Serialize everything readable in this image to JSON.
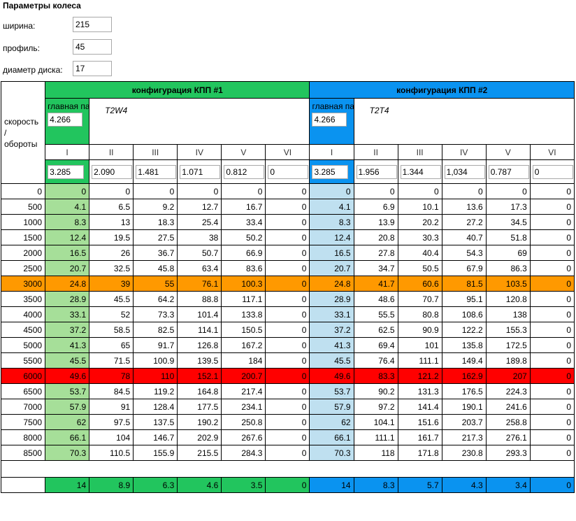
{
  "section_title": "Параметры колеса",
  "params": {
    "width_label": "ширина:",
    "width_value": "215",
    "profile_label": "профиль:",
    "profile_value": "45",
    "disk_label": "диаметр диска:",
    "disk_value": "17"
  },
  "table": {
    "speed_header": "скорость / обороты",
    "config1": {
      "title": "конфигурация КПП #1",
      "main_pair_label": "главная пара",
      "main_pair_value": "4.266",
      "name": "T2W4",
      "gears": [
        "I",
        "II",
        "III",
        "IV",
        "V",
        "VI"
      ],
      "ratios": [
        "3.285",
        "2.090",
        "1.481",
        "1.071",
        "0.812",
        "0"
      ]
    },
    "config2": {
      "title": "конфигурация КПП #2",
      "main_pair_label": "главная пара",
      "main_pair_value": "4.266",
      "name": "T2T4",
      "gears": [
        "I",
        "II",
        "III",
        "IV",
        "V",
        "VI"
      ],
      "ratios": [
        "3.285",
        "1.956",
        "1.344",
        "1,034",
        "0.787",
        "0"
      ]
    },
    "rows": [
      {
        "rpm": "0",
        "c1": [
          "0",
          "0",
          "0",
          "0",
          "0",
          "0"
        ],
        "c2": [
          "0",
          "0",
          "0",
          "0",
          "0",
          "0"
        ]
      },
      {
        "rpm": "500",
        "c1": [
          "4.1",
          "6.5",
          "9.2",
          "12.7",
          "16.7",
          "0"
        ],
        "c2": [
          "4.1",
          "6.9",
          "10.1",
          "13.6",
          "17.3",
          "0"
        ]
      },
      {
        "rpm": "1000",
        "c1": [
          "8.3",
          "13",
          "18.3",
          "25.4",
          "33.4",
          "0"
        ],
        "c2": [
          "8.3",
          "13.9",
          "20.2",
          "27.2",
          "34.5",
          "0"
        ]
      },
      {
        "rpm": "1500",
        "c1": [
          "12.4",
          "19.5",
          "27.5",
          "38",
          "50.2",
          "0"
        ],
        "c2": [
          "12.4",
          "20.8",
          "30.3",
          "40.7",
          "51.8",
          "0"
        ]
      },
      {
        "rpm": "2000",
        "c1": [
          "16.5",
          "26",
          "36.7",
          "50.7",
          "66.9",
          "0"
        ],
        "c2": [
          "16.5",
          "27.8",
          "40.4",
          "54.3",
          "69",
          "0"
        ]
      },
      {
        "rpm": "2500",
        "c1": [
          "20.7",
          "32.5",
          "45.8",
          "63.4",
          "83.6",
          "0"
        ],
        "c2": [
          "20.7",
          "34.7",
          "50.5",
          "67.9",
          "86.3",
          "0"
        ]
      },
      {
        "rpm": "3000",
        "highlight": "orange",
        "c1": [
          "24.8",
          "39",
          "55",
          "76.1",
          "100.3",
          "0"
        ],
        "c2": [
          "24.8",
          "41.7",
          "60.6",
          "81.5",
          "103.5",
          "0"
        ]
      },
      {
        "rpm": "3500",
        "c1": [
          "28.9",
          "45.5",
          "64.2",
          "88.8",
          "117.1",
          "0"
        ],
        "c2": [
          "28.9",
          "48.6",
          "70.7",
          "95.1",
          "120.8",
          "0"
        ]
      },
      {
        "rpm": "4000",
        "c1": [
          "33.1",
          "52",
          "73.3",
          "101.4",
          "133.8",
          "0"
        ],
        "c2": [
          "33.1",
          "55.5",
          "80.8",
          "108.6",
          "138",
          "0"
        ]
      },
      {
        "rpm": "4500",
        "c1": [
          "37.2",
          "58.5",
          "82.5",
          "114.1",
          "150.5",
          "0"
        ],
        "c2": [
          "37.2",
          "62.5",
          "90.9",
          "122.2",
          "155.3",
          "0"
        ]
      },
      {
        "rpm": "5000",
        "c1": [
          "41.3",
          "65",
          "91.7",
          "126.8",
          "167.2",
          "0"
        ],
        "c2": [
          "41.3",
          "69.4",
          "101",
          "135.8",
          "172.5",
          "0"
        ]
      },
      {
        "rpm": "5500",
        "c1": [
          "45.5",
          "71.5",
          "100.9",
          "139.5",
          "184",
          "0"
        ],
        "c2": [
          "45.5",
          "76.4",
          "111.1",
          "149.4",
          "189.8",
          "0"
        ]
      },
      {
        "rpm": "6000",
        "highlight": "red",
        "c1": [
          "49.6",
          "78",
          "110",
          "152.1",
          "200.7",
          "0"
        ],
        "c2": [
          "49.6",
          "83.3",
          "121.2",
          "162.9",
          "207",
          "0"
        ]
      },
      {
        "rpm": "6500",
        "c1": [
          "53.7",
          "84.5",
          "119.2",
          "164.8",
          "217.4",
          "0"
        ],
        "c2": [
          "53.7",
          "90.2",
          "131.3",
          "176.5",
          "224.3",
          "0"
        ]
      },
      {
        "rpm": "7000",
        "c1": [
          "57.9",
          "91",
          "128.4",
          "177.5",
          "234.1",
          "0"
        ],
        "c2": [
          "57.9",
          "97.2",
          "141.4",
          "190.1",
          "241.6",
          "0"
        ]
      },
      {
        "rpm": "7500",
        "c1": [
          "62",
          "97.5",
          "137.5",
          "190.2",
          "250.8",
          "0"
        ],
        "c2": [
          "62",
          "104.1",
          "151.6",
          "203.7",
          "258.8",
          "0"
        ]
      },
      {
        "rpm": "8000",
        "c1": [
          "66.1",
          "104",
          "146.7",
          "202.9",
          "267.6",
          "0"
        ],
        "c2": [
          "66.1",
          "111.1",
          "161.7",
          "217.3",
          "276.1",
          "0"
        ]
      },
      {
        "rpm": "8500",
        "c1": [
          "70.3",
          "110.5",
          "155.9",
          "215.5",
          "284.3",
          "0"
        ],
        "c2": [
          "70.3",
          "118",
          "171.8",
          "230.8",
          "293.3",
          "0"
        ]
      }
    ],
    "footer": {
      "c1": [
        "14",
        "8.9",
        "6.3",
        "4.6",
        "3.5",
        "0"
      ],
      "c2": [
        "14",
        "8.3",
        "5.7",
        "4.3",
        "3.4",
        "0"
      ]
    }
  },
  "colors": {
    "config1_header": "#22c55e",
    "config2_header": "#0a93f0",
    "col1_green": "#a6df99",
    "col1_blue": "#bfe0f0",
    "highlight_orange": "#ff9900",
    "highlight_red": "#ff0000"
  }
}
